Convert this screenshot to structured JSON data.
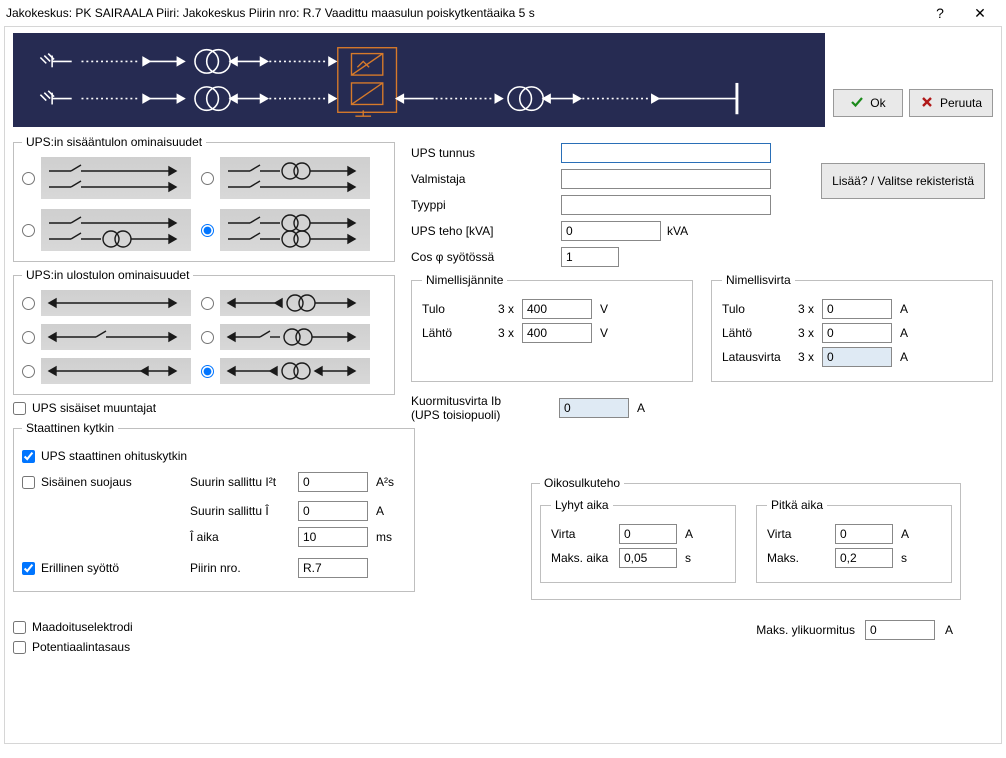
{
  "titlebar": {
    "text": "Jakokeskus: PK SAIRAALA    Piiri: Jakokeskus    Piirin nro: R.7   Vaadittu maasulun poiskytkentäaika 5 s"
  },
  "buttons": {
    "ok": "Ok",
    "cancel": "Peruuta",
    "add": "Lisää? / Valitse rekisteristä"
  },
  "groups": {
    "input_props": "UPS:in sisääntulon ominaisuudet",
    "output_props": "UPS:in ulostulon ominaisuudet",
    "static_switch": "Staattinen kytkin",
    "nom_voltage": "Nimellisjännite",
    "nom_current": "Nimellisvirta",
    "short_circuit": "Oikosulkuteho",
    "short_time": "Lyhyt aika",
    "long_time": "Pitkä aika"
  },
  "labels": {
    "ups_id": "UPS tunnus",
    "manufacturer": "Valmistaja",
    "type": "Tyyppi",
    "ups_power": "UPS teho [kVA]",
    "cosphi": "Cos  φ   syötössä",
    "in": "Tulo",
    "out": "Lähtö",
    "charge": "Latausvirta",
    "load_current": "Kuormitusvirta Ib\n(UPS toisiopuoli)",
    "internal_tx": "UPS sisäiset muuntajat",
    "static_bypass": "UPS staattinen ohituskytkin",
    "internal_prot": "Sisäinen suojaus",
    "max_i2t": "Suurin sallittu  I²t",
    "max_i": "Suurin sallittu Î",
    "i_time": "Î aika",
    "sep_supply": "Erillinen syöttö",
    "circuit_no": "Piirin nro.",
    "current": "Virta",
    "max_time": "Maks. aika",
    "max": "Maks.",
    "max_overload": "Maks. ylikuormitus",
    "ground_elec": "Maadoituselektrodi",
    "equipot": "Potentiaalintasaus",
    "three_x": "3 x",
    "kva": "kVA",
    "V": "V",
    "A": "A",
    "A2s": "A²s",
    "ms": "ms",
    "s": "s"
  },
  "values": {
    "ups_id": "",
    "manufacturer": "",
    "type": "",
    "ups_power": "0",
    "cosphi": "1",
    "volt_in": "400",
    "volt_out": "400",
    "cur_in": "0",
    "cur_out": "0",
    "cur_charge": "0",
    "load_ib": "0",
    "i2t": "0",
    "imax": "0",
    "itime": "10",
    "circuit_no": "R.7",
    "short_i": "0",
    "short_t": "0,05",
    "long_i": "0",
    "long_t": "0,2",
    "max_over": "0",
    "chk_internal_tx": false,
    "chk_static_bypass": true,
    "chk_internal_prot": false,
    "chk_sep_supply": true,
    "chk_ground": false,
    "chk_equipot": false
  }
}
